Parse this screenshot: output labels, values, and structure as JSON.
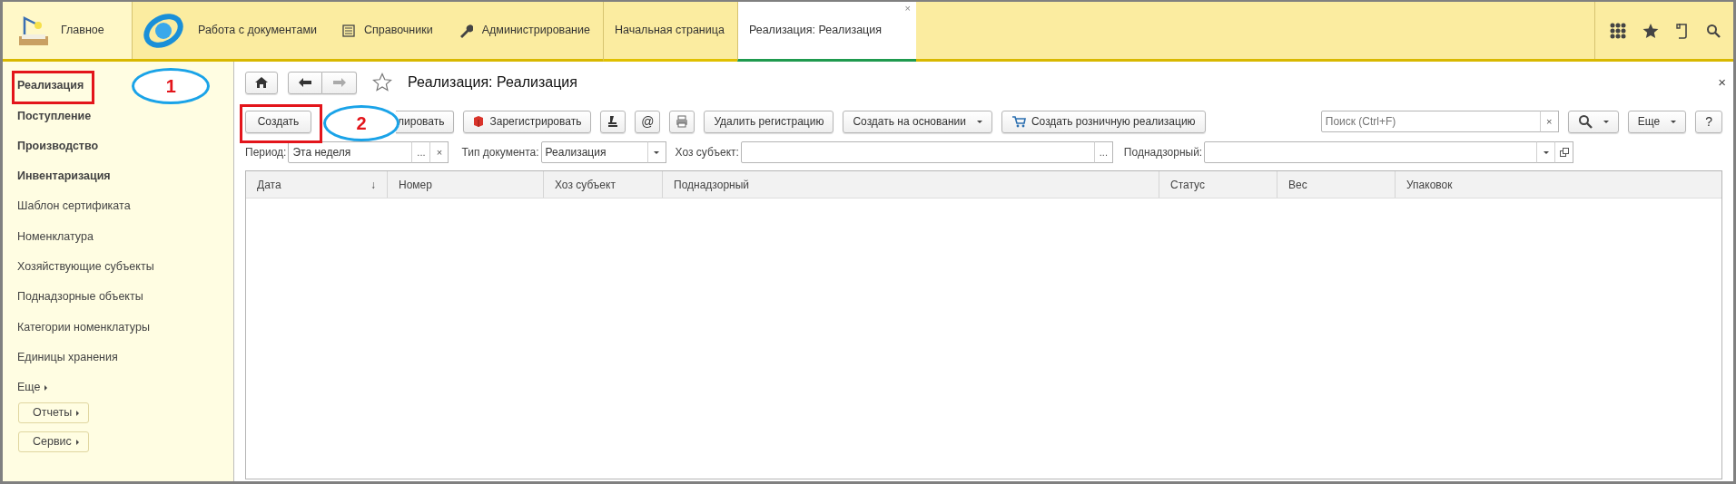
{
  "top_nav": {
    "home": {
      "label": "Главное"
    },
    "sections": [
      {
        "label": "Работа с документами"
      },
      {
        "label": "Справочники"
      },
      {
        "label": "Администрирование"
      }
    ],
    "open_tabs": [
      {
        "label": "Начальная страница",
        "selected": false
      },
      {
        "label": "Реализация: Реализация",
        "selected": true,
        "close": "×"
      }
    ]
  },
  "sidebar": {
    "items": [
      {
        "label": "Реализация",
        "bold": true
      },
      {
        "label": "Поступление",
        "bold": true
      },
      {
        "label": "Производство",
        "bold": true
      },
      {
        "label": "Инвентаризация",
        "bold": true
      },
      {
        "label": "Шаблон сертификата",
        "bold": false
      },
      {
        "label": "Номенклатура",
        "bold": false
      },
      {
        "label": "Хозяйствующие субъекты",
        "bold": false
      },
      {
        "label": "Поднадзорные объекты",
        "bold": false
      },
      {
        "label": "Категории номенклатуры",
        "bold": false
      },
      {
        "label": "Единицы хранения",
        "bold": false
      }
    ],
    "more": "Еще",
    "buttons": [
      "Отчеты",
      "Сервис"
    ]
  },
  "form": {
    "title": "Реализация: Реализация",
    "close": "×",
    "toolbar": [
      {
        "kind": "text",
        "label": "Создать"
      },
      {
        "kind": "text",
        "label": "лировать"
      },
      {
        "kind": "icon_text",
        "label": "Зарегистрировать"
      },
      {
        "kind": "icon"
      },
      {
        "kind": "glyph",
        "label": "@"
      },
      {
        "kind": "icon"
      },
      {
        "kind": "text",
        "label": "Удалить регистрацию"
      },
      {
        "kind": "dropdown",
        "label": "Создать на основании"
      },
      {
        "kind": "icon_text",
        "label": "Создать розничную реализацию"
      }
    ],
    "search": {
      "placeholder": "Поиск (Ctrl+F)",
      "clear": "×"
    },
    "more_button": "Еще",
    "help_button": "?",
    "filters": [
      {
        "label": "Период:",
        "value": "Эта неделя",
        "kind": "choice",
        "button": "...",
        "clear": "×"
      },
      {
        "label": "Тип документа:",
        "value": "Реализация",
        "kind": "dropdown"
      },
      {
        "label": "Хоз субъект:",
        "kind": "choice",
        "button": "..."
      },
      {
        "label": "Поднадзорный:",
        "kind": "dropdown_open"
      }
    ],
    "table": {
      "columns": [
        {
          "label": "Дата",
          "sort": "↓"
        },
        {
          "label": "Номер"
        },
        {
          "label": "Хоз субъект"
        },
        {
          "label": "Поднадзорный"
        },
        {
          "label": "Статус"
        },
        {
          "label": "Вес"
        },
        {
          "label": "Упаковок"
        }
      ]
    }
  },
  "annotations": [
    {
      "label": "1"
    },
    {
      "label": "2"
    }
  ]
}
